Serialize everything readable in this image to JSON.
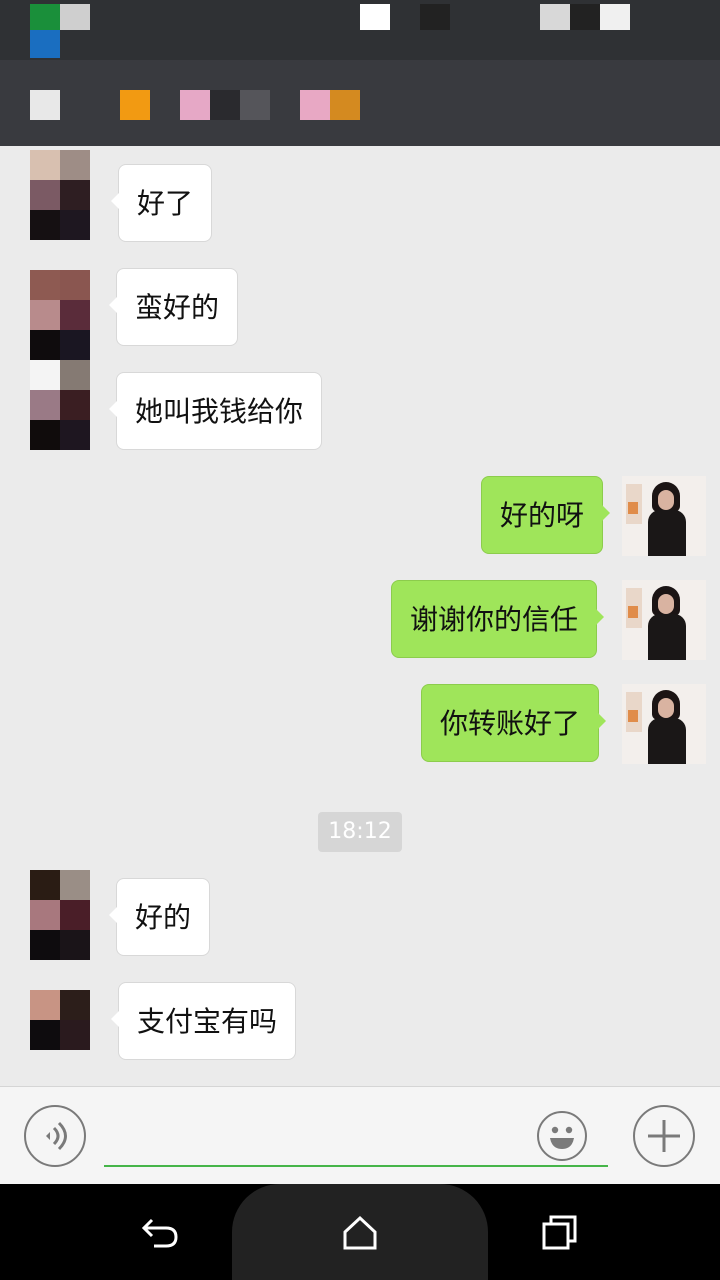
{
  "colors": {
    "incoming_bubble": "#ffffff",
    "outgoing_bubble": "#9fe55a",
    "chat_background": "#ebebeb",
    "title_bar": "#393a3f",
    "input_underline": "#46b549"
  },
  "messages": [
    {
      "side": "incoming",
      "text": "好了"
    },
    {
      "side": "incoming",
      "text": "蛮好的"
    },
    {
      "side": "incoming",
      "text": "她叫我钱给你"
    },
    {
      "side": "outgoing",
      "text": "好的呀"
    },
    {
      "side": "outgoing",
      "text": "谢谢你的信任"
    },
    {
      "side": "outgoing",
      "text": "你转账好了"
    },
    {
      "side": "incoming",
      "text": "好的"
    },
    {
      "side": "incoming",
      "text": "支付宝有吗"
    }
  ],
  "timestamp": "18:12",
  "input": {
    "value": "",
    "placeholder": ""
  },
  "icons": {
    "voice": "voice-icon",
    "emoji": "emoji-icon",
    "plus": "plus-icon",
    "back": "back-icon",
    "home": "home-icon",
    "recents": "recents-icon"
  }
}
